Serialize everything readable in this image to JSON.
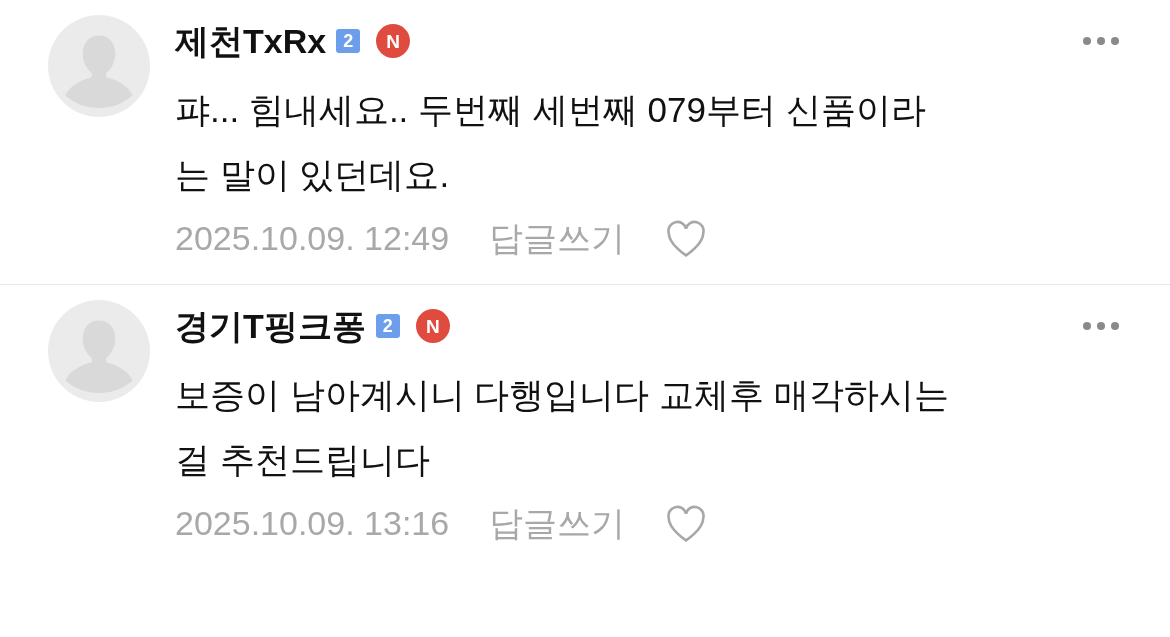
{
  "comments": [
    {
      "author": "제천TxRx",
      "level_badge": "2",
      "new_badge": "N",
      "body_lines": [
        "퍄... 힘내세요.. 두번째 세번째 079부터 신품이라",
        "는 말이 있던데요."
      ],
      "date": "2025.10.09. 12:49",
      "reply": "답글쓰기"
    },
    {
      "author": "경기T핑크퐁",
      "level_badge": "2",
      "new_badge": "N",
      "body_lines": [
        "보증이 남아계시니 다행입니다 교체후 매각하시는",
        "걸 추천드립니다"
      ],
      "date": "2025.10.09. 13:16",
      "reply": "답글쓰기"
    }
  ]
}
